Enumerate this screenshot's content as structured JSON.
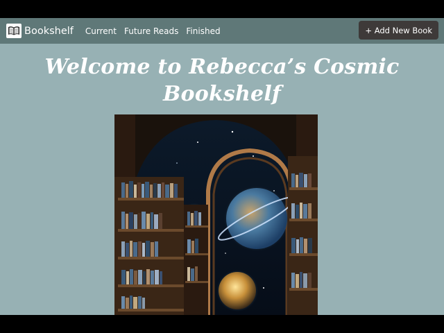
{
  "navbar": {
    "brand_label": "Bookshelf",
    "links": [
      "Current",
      "Future Reads",
      "Finished"
    ],
    "add_button_label": "+ Add New Book",
    "colors": {
      "navbar_bg": "#5f7878",
      "button_bg": "#3e3a39"
    }
  },
  "page": {
    "title": "Welcome to Rebecca’s Cosmic Bookshelf",
    "background": "#97b1b4"
  },
  "icons": [
    "open-book-icon"
  ]
}
